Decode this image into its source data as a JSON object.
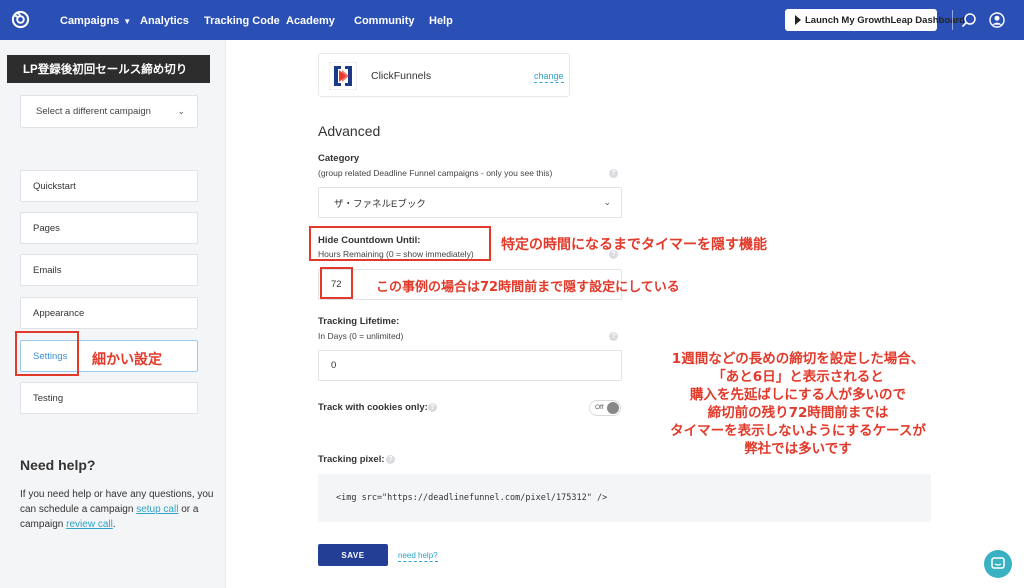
{
  "topnav": {
    "items": [
      {
        "label": "Campaigns",
        "has_caret": true
      },
      {
        "label": "Analytics"
      },
      {
        "label": "Tracking Code"
      },
      {
        "label": "Academy"
      },
      {
        "label": "Community"
      },
      {
        "label": "Help"
      }
    ],
    "launch_button": "Launch My GrowthLeap Dashboard",
    "bar_color": "#2a4fb5"
  },
  "sidebar": {
    "campaign_name": "LP登録後初回セールス締め切り",
    "campaign_select_placeholder": "Select a different campaign",
    "items": [
      {
        "label": "Quickstart"
      },
      {
        "label": "Pages"
      },
      {
        "label": "Emails"
      },
      {
        "label": "Appearance"
      },
      {
        "label": "Settings",
        "active": true
      },
      {
        "label": "Testing"
      }
    ],
    "need_help": {
      "title": "Need help?",
      "text_before": "If you need help or have any questions, you can schedule a campaign ",
      "setup_call": "setup call",
      "text_middle": " or a campaign ",
      "review_call": "review call",
      "text_after": "."
    }
  },
  "main": {
    "integration": {
      "name": "ClickFunnels",
      "change_label": "change"
    },
    "advanced_title": "Advanced",
    "category": {
      "label": "Category",
      "help": "(group related Deadline Funnel campaigns - only you see this)",
      "value": "ザ・ファネルEブック"
    },
    "hide_countdown": {
      "label": "Hide Countdown Until:",
      "help": "Hours Remaining (0 = show immediately)",
      "value": "72"
    },
    "tracking_lifetime": {
      "label": "Tracking Lifetime:",
      "help": "In Days (0 = unlimited)",
      "value": "0"
    },
    "cookies": {
      "label": "Track with cookies only:",
      "toggle_label": "Off"
    },
    "tracking_pixel": {
      "label": "Tracking pixel:",
      "code": "<img src=\"https://deadlinefunnel.com/pixel/175312\" />"
    },
    "save_label": "SAVE",
    "need_help_link": "need help?"
  },
  "annotations": {
    "hide_feature": "特定の時間になるまでタイマーを隠す機能",
    "example_72": "この事例の場合は72時間前まで隠す設定にしている",
    "settings_note": "細かい設定",
    "explanation_lines": [
      "1週間などの長めの締切を設定した場合、",
      "「あと6日」と表示されると",
      "購入を先延ばしにする人が多いので",
      "締切前の残り72時間前までは",
      "タイマーを表示しないようにするケースが",
      "弊社では多いです"
    ],
    "color": "#e23a2a"
  }
}
